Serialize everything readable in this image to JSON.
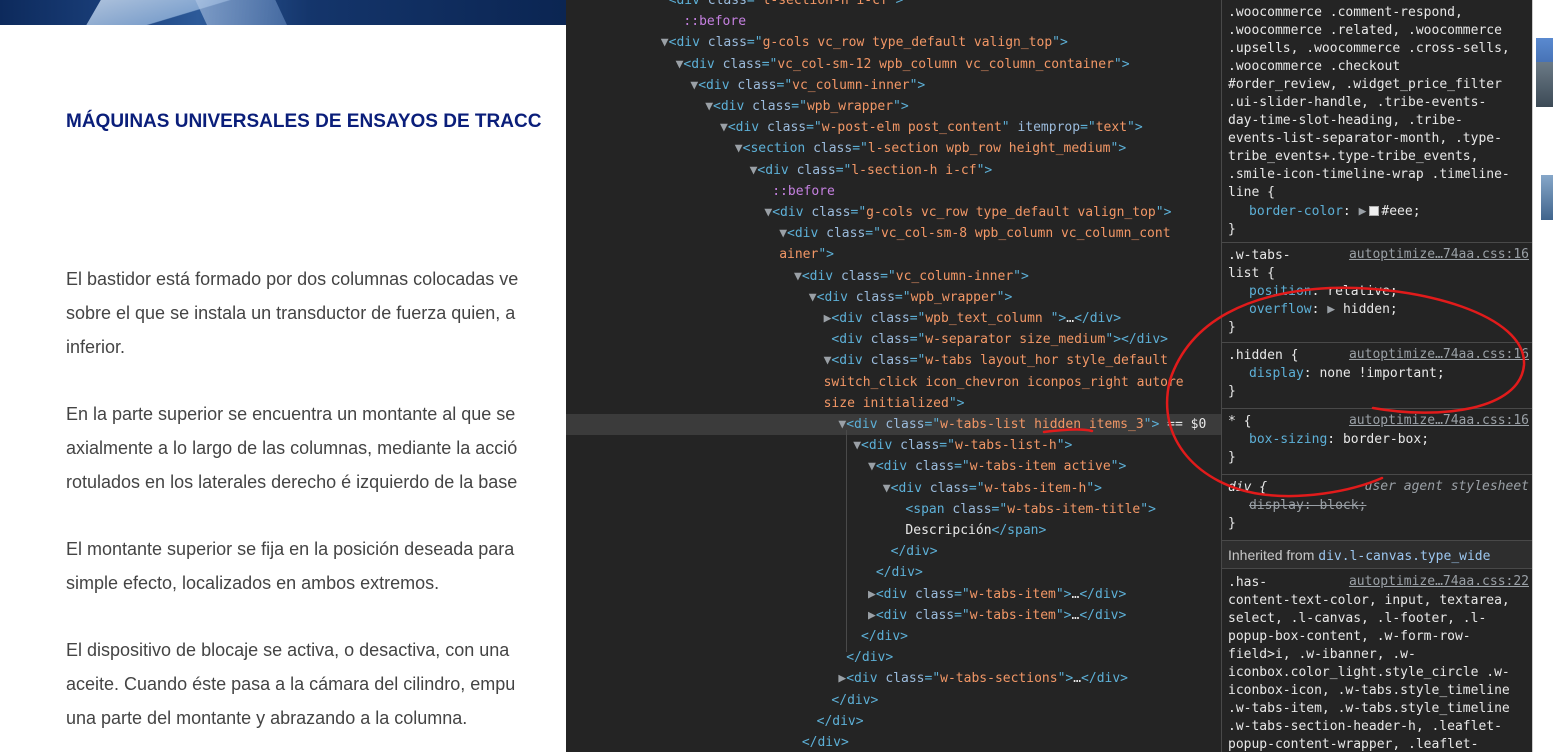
{
  "webpage": {
    "heading": "MÁQUINAS UNIVERSALES DE ENSAYOS DE TRACC",
    "paragraphs": [
      [
        "El bastidor está formado por dos columnas colocadas ve",
        "sobre el que se instala un transductor de fuerza quien, a",
        "inferior."
      ],
      [
        "En la parte superior se encuentra un montante al que se",
        "axialmente a lo largo de las columnas, mediante la acció",
        "rotulados en los laterales derecho é izquierdo de la base"
      ],
      [
        "El montante superior se fija en la posición deseada para",
        "simple efecto, localizados en ambos extremos."
      ],
      [
        "El dispositivo de blocaje se activa, o desactiva, con una",
        "aceite. Cuando éste pasa a la cámara del cilindro, empu",
        "una parte del montante y abrazando a la columna."
      ]
    ]
  },
  "elements_panel": {
    "selected_marker": "...",
    "lines": [
      {
        "indent": 6,
        "tri": "",
        "parts": [
          [
            "tag",
            "<div "
          ],
          [
            "an",
            "class"
          ],
          [
            "tag",
            "=\""
          ],
          [
            "av",
            "l-section-h i-cf"
          ],
          [
            "tag",
            "\">"
          ]
        ]
      },
      {
        "indent": 7,
        "tri": "",
        "parts": [
          [
            "pseudo",
            "::before"
          ]
        ]
      },
      {
        "indent": 6,
        "tri": "▼",
        "parts": [
          [
            "tag",
            "<div "
          ],
          [
            "an",
            "class"
          ],
          [
            "tag",
            "=\""
          ],
          [
            "av",
            "g-cols vc_row type_default valign_top"
          ],
          [
            "tag",
            "\">"
          ]
        ]
      },
      {
        "indent": 7,
        "tri": "▼",
        "parts": [
          [
            "tag",
            "<div "
          ],
          [
            "an",
            "class"
          ],
          [
            "tag",
            "=\""
          ],
          [
            "av",
            "vc_col-sm-12 wpb_column vc_column_container"
          ],
          [
            "tag",
            "\">"
          ]
        ]
      },
      {
        "indent": 8,
        "tri": "▼",
        "parts": [
          [
            "tag",
            "<div "
          ],
          [
            "an",
            "class"
          ],
          [
            "tag",
            "=\""
          ],
          [
            "av",
            "vc_column-inner"
          ],
          [
            "tag",
            "\">"
          ]
        ]
      },
      {
        "indent": 9,
        "tri": "▼",
        "parts": [
          [
            "tag",
            "<div "
          ],
          [
            "an",
            "class"
          ],
          [
            "tag",
            "=\""
          ],
          [
            "av",
            "wpb_wrapper"
          ],
          [
            "tag",
            "\">"
          ]
        ]
      },
      {
        "indent": 10,
        "tri": "▼",
        "parts": [
          [
            "tag",
            "<div "
          ],
          [
            "an",
            "class"
          ],
          [
            "tag",
            "=\""
          ],
          [
            "av",
            "w-post-elm post_content"
          ],
          [
            "tag",
            "\" "
          ],
          [
            "an",
            "itemprop"
          ],
          [
            "tag",
            "=\""
          ],
          [
            "av",
            "text"
          ],
          [
            "tag",
            "\">"
          ]
        ]
      },
      {
        "indent": 11,
        "tri": "▼",
        "parts": [
          [
            "tag",
            "<section "
          ],
          [
            "an",
            "class"
          ],
          [
            "tag",
            "=\""
          ],
          [
            "av",
            "l-section wpb_row height_medium"
          ],
          [
            "tag",
            "\">"
          ]
        ]
      },
      {
        "indent": 12,
        "tri": "▼",
        "parts": [
          [
            "tag",
            "<div "
          ],
          [
            "an",
            "class"
          ],
          [
            "tag",
            "=\""
          ],
          [
            "av",
            "l-section-h i-cf"
          ],
          [
            "tag",
            "\">"
          ]
        ]
      },
      {
        "indent": 13,
        "tri": "",
        "parts": [
          [
            "pseudo",
            "::before"
          ]
        ]
      },
      {
        "indent": 13,
        "tri": "▼",
        "parts": [
          [
            "tag",
            "<div "
          ],
          [
            "an",
            "class"
          ],
          [
            "tag",
            "=\""
          ],
          [
            "av",
            "g-cols vc_row type_default valign_top"
          ],
          [
            "tag",
            "\">"
          ]
        ]
      },
      {
        "indent": 14,
        "tri": "▼",
        "parts": [
          [
            "tag",
            "<div "
          ],
          [
            "an",
            "class"
          ],
          [
            "tag",
            "=\""
          ],
          [
            "av",
            "vc_col-sm-8 wpb_column vc_column_cont"
          ]
        ]
      },
      {
        "indent": 14,
        "tri": "",
        "parts": [
          [
            "av",
            "ainer"
          ],
          [
            "tag",
            "\">"
          ]
        ],
        "cont": true
      },
      {
        "indent": 15,
        "tri": "▼",
        "parts": [
          [
            "tag",
            "<div "
          ],
          [
            "an",
            "class"
          ],
          [
            "tag",
            "=\""
          ],
          [
            "av",
            "vc_column-inner"
          ],
          [
            "tag",
            "\">"
          ]
        ]
      },
      {
        "indent": 16,
        "tri": "▼",
        "parts": [
          [
            "tag",
            "<div "
          ],
          [
            "an",
            "class"
          ],
          [
            "tag",
            "=\""
          ],
          [
            "av",
            "wpb_wrapper"
          ],
          [
            "tag",
            "\">"
          ]
        ]
      },
      {
        "indent": 17,
        "tri": "▶",
        "parts": [
          [
            "tag",
            "<div "
          ],
          [
            "an",
            "class"
          ],
          [
            "tag",
            "=\""
          ],
          [
            "av",
            "wpb_text_column "
          ],
          [
            "tag",
            "\">"
          ],
          [
            "txt",
            "…"
          ],
          [
            "tag",
            "</div>"
          ]
        ]
      },
      {
        "indent": 17,
        "tri": "",
        "parts": [
          [
            "tag",
            "<div "
          ],
          [
            "an",
            "class"
          ],
          [
            "tag",
            "=\""
          ],
          [
            "av",
            "w-separator size_medium"
          ],
          [
            "tag",
            "\"></div>"
          ]
        ]
      },
      {
        "indent": 17,
        "tri": "▼",
        "parts": [
          [
            "tag",
            "<div "
          ],
          [
            "an",
            "class"
          ],
          [
            "tag",
            "=\""
          ],
          [
            "av",
            "w-tabs layout_hor style_default"
          ]
        ]
      },
      {
        "indent": 17,
        "tri": "",
        "parts": [
          [
            "av",
            "switch_click icon_chevron iconpos_right autore"
          ]
        ],
        "cont": true
      },
      {
        "indent": 17,
        "tri": "",
        "parts": [
          [
            "av",
            "size initialized"
          ],
          [
            "tag",
            "\">"
          ]
        ],
        "cont": true
      },
      {
        "indent": 18,
        "tri": "▼",
        "parts": [
          [
            "tag",
            "<div "
          ],
          [
            "an",
            "class"
          ],
          [
            "tag",
            "=\""
          ],
          [
            "av",
            "w-tabs-list hidden items_3"
          ],
          [
            "tag",
            "\">"
          ],
          [
            "txt",
            " == $0"
          ]
        ],
        "selected": true
      },
      {
        "indent": 19,
        "tri": "▼",
        "parts": [
          [
            "tag",
            "<div "
          ],
          [
            "an",
            "class"
          ],
          [
            "tag",
            "=\""
          ],
          [
            "av",
            "w-tabs-list-h"
          ],
          [
            "tag",
            "\">"
          ]
        ]
      },
      {
        "indent": 20,
        "tri": "▼",
        "parts": [
          [
            "tag",
            "<div "
          ],
          [
            "an",
            "class"
          ],
          [
            "tag",
            "=\""
          ],
          [
            "av",
            "w-tabs-item active"
          ],
          [
            "tag",
            "\">"
          ]
        ]
      },
      {
        "indent": 21,
        "tri": "▼",
        "parts": [
          [
            "tag",
            "<div "
          ],
          [
            "an",
            "class"
          ],
          [
            "tag",
            "=\""
          ],
          [
            "av",
            "w-tabs-item-h"
          ],
          [
            "tag",
            "\">"
          ]
        ]
      },
      {
        "indent": 22,
        "tri": "",
        "parts": [
          [
            "tag",
            "<span "
          ],
          [
            "an",
            "class"
          ],
          [
            "tag",
            "=\""
          ],
          [
            "av",
            "w-tabs-item-title"
          ],
          [
            "tag",
            "\">"
          ]
        ]
      },
      {
        "indent": 22,
        "tri": "",
        "parts": [
          [
            "txt",
            "Descripción"
          ],
          [
            "tag",
            "</span>"
          ]
        ]
      },
      {
        "indent": 21,
        "tri": "",
        "parts": [
          [
            "tag",
            "</div>"
          ]
        ]
      },
      {
        "indent": 20,
        "tri": "",
        "parts": [
          [
            "tag",
            "</div>"
          ]
        ]
      },
      {
        "indent": 20,
        "tri": "▶",
        "parts": [
          [
            "tag",
            "<div "
          ],
          [
            "an",
            "class"
          ],
          [
            "tag",
            "=\""
          ],
          [
            "av",
            "w-tabs-item"
          ],
          [
            "tag",
            "\">"
          ],
          [
            "txt",
            "…"
          ],
          [
            "tag",
            "</div>"
          ]
        ]
      },
      {
        "indent": 20,
        "tri": "▶",
        "parts": [
          [
            "tag",
            "<div "
          ],
          [
            "an",
            "class"
          ],
          [
            "tag",
            "=\""
          ],
          [
            "av",
            "w-tabs-item"
          ],
          [
            "tag",
            "\">"
          ],
          [
            "txt",
            "…"
          ],
          [
            "tag",
            "</div>"
          ]
        ]
      },
      {
        "indent": 19,
        "tri": "",
        "parts": [
          [
            "tag",
            "</div>"
          ]
        ]
      },
      {
        "indent": 18,
        "tri": "",
        "parts": [
          [
            "tag",
            "</div>"
          ]
        ]
      },
      {
        "indent": 18,
        "tri": "▶",
        "parts": [
          [
            "tag",
            "<div "
          ],
          [
            "an",
            "class"
          ],
          [
            "tag",
            "=\""
          ],
          [
            "av",
            "w-tabs-sections"
          ],
          [
            "tag",
            "\">"
          ],
          [
            "txt",
            "…"
          ],
          [
            "tag",
            "</div>"
          ]
        ]
      },
      {
        "indent": 17,
        "tri": "",
        "parts": [
          [
            "tag",
            "</div>"
          ]
        ]
      },
      {
        "indent": 16,
        "tri": "",
        "parts": [
          [
            "tag",
            "</div>"
          ]
        ]
      },
      {
        "indent": 15,
        "tri": "",
        "parts": [
          [
            "tag",
            "</div>"
          ]
        ]
      }
    ]
  },
  "styles_panel": {
    "rule1": {
      "selector_lines": [
        ".woocommerce .comment-respond,",
        ".woocommerce .related, .woocommerce",
        ".upsells, .woocommerce .cross-sells,",
        ".woocommerce .checkout",
        "#order_review, .widget_price_filter",
        ".ui-slider-handle, .tribe-events-",
        "day-time-slot-heading, .tribe-",
        "events-list-separator-month, .type-",
        "tribe_events+.type-tribe_events,",
        ".smile-icon-timeline-wrap .timeline-",
        "line {"
      ],
      "prop": "border-color",
      "value": "#eee"
    },
    "rule2": {
      "selector_a": ".w-tabs-",
      "selector_b": "list {",
      "source": "autoptimize…74aa.css:16",
      "decl1_prop": "position",
      "decl1_value": "relative",
      "decl2_prop": "overflow",
      "decl2_value": "hidden"
    },
    "rule3": {
      "selector": ".hidden {",
      "source": "autoptimize…74aa.css:16",
      "prop": "display",
      "value": "none !important"
    },
    "rule4": {
      "selector": "* {",
      "source": "autoptimize…74aa.css:16",
      "prop": "box-sizing",
      "value": "border-box"
    },
    "rule5": {
      "selector": "div {",
      "source": "user agent stylesheet",
      "prop": "display",
      "value": "block"
    },
    "inherited_label": "Inherited from",
    "inherited_link": "div.l-canvas.type_wide",
    "rule6": {
      "source": "autoptimize…74aa.css:22",
      "selector_lines": [
        ".has-",
        "content-text-color, input, textarea,",
        "select, .l-canvas, .l-footer, .l-",
        "popup-box-content, .w-form-row-",
        "field>i, .w-ibanner, .w-",
        "iconbox.color_light.style_circle .w-",
        "iconbox-icon, .w-tabs.style_timeline",
        ".w-tabs-item, .w-tabs.style_timeline",
        ".w-tabs-section-header-h, .leaflet-",
        "popup-content-wrapper, .leaflet-"
      ]
    },
    "closing_brace": "}"
  },
  "colors": {
    "annotation": "#e11b1b",
    "devtools_bg": "#242424"
  }
}
